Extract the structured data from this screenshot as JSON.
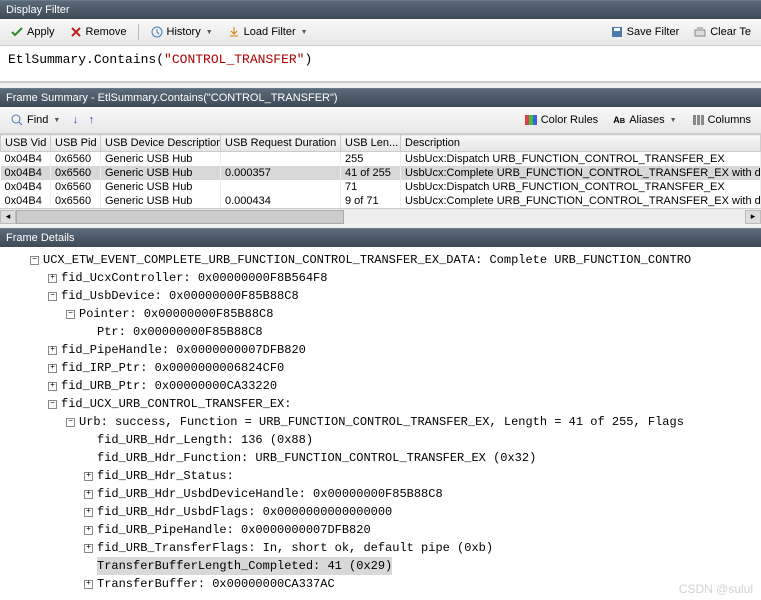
{
  "display_filter": {
    "title": "Display Filter",
    "apply": "Apply",
    "remove": "Remove",
    "history": "History",
    "load_filter": "Load Filter",
    "save_filter": "Save Filter",
    "clear_text": "Clear Te",
    "expr_fn": "EtlSummary.Contains",
    "expr_arg": "\"CONTROL_TRANSFER\""
  },
  "frame_summary": {
    "title": "Frame Summary - EtlSummary.Contains(\"CONTROL_TRANSFER\")",
    "find": "Find",
    "color_rules": "Color Rules",
    "aliases": "Aliases",
    "columns": "Columns",
    "headers": [
      "USB Vid",
      "USB Pid",
      "USB Device Description",
      "USB Request Duration",
      "USB Len...",
      "Description"
    ],
    "rows": [
      {
        "vid": "0x04B4",
        "pid": "0x6560",
        "desc": "Generic USB Hub",
        "dur": "",
        "len": "255",
        "d": "UsbUcx:Dispatch URB_FUNCTION_CONTROL_TRANSFER_EX",
        "sel": false
      },
      {
        "vid": "0x04B4",
        "pid": "0x6560",
        "desc": "Generic USB Hub",
        "dur": "0.000357",
        "len": "41 of 255",
        "d": "UsbUcx:Complete URB_FUNCTION_CONTROL_TRANSFER_EX with data",
        "sel": true
      },
      {
        "vid": "0x04B4",
        "pid": "0x6560",
        "desc": "Generic USB Hub",
        "dur": "",
        "len": "71",
        "d": "UsbUcx:Dispatch URB_FUNCTION_CONTROL_TRANSFER_EX",
        "sel": false
      },
      {
        "vid": "0x04B4",
        "pid": "0x6560",
        "desc": "Generic USB Hub",
        "dur": "0.000434",
        "len": "9 of 71",
        "d": "UsbUcx:Complete URB_FUNCTION_CONTROL_TRANSFER_EX with data",
        "sel": false
      }
    ]
  },
  "frame_details": {
    "title": "Frame Details",
    "lines": [
      {
        "ind": 1,
        "box": "-",
        "txt": "UCX_ETW_EVENT_COMPLETE_URB_FUNCTION_CONTROL_TRANSFER_EX_DATA: Complete URB_FUNCTION_CONTRO"
      },
      {
        "ind": 2,
        "box": "+",
        "txt": "fid_UcxController: 0x00000000F8B564F8"
      },
      {
        "ind": 2,
        "box": "-",
        "txt": "fid_UsbDevice: 0x00000000F85B88C8"
      },
      {
        "ind": 3,
        "box": "-",
        "txt": "Pointer: 0x00000000F85B88C8"
      },
      {
        "ind": 4,
        "box": "",
        "txt": "Ptr: 0x00000000F85B88C8"
      },
      {
        "ind": 2,
        "box": "+",
        "txt": "fid_PipeHandle: 0x0000000007DFB820"
      },
      {
        "ind": 2,
        "box": "+",
        "txt": "fid_IRP_Ptr: 0x0000000006824CF0"
      },
      {
        "ind": 2,
        "box": "+",
        "txt": "fid_URB_Ptr: 0x00000000CA33220"
      },
      {
        "ind": 2,
        "box": "-",
        "txt": "fid_UCX_URB_CONTROL_TRANSFER_EX:"
      },
      {
        "ind": 3,
        "box": "-",
        "txt": "Urb: success, Function = URB_FUNCTION_CONTROL_TRANSFER_EX, Length = 41 of 255, Flags "
      },
      {
        "ind": 4,
        "box": "",
        "txt": "fid_URB_Hdr_Length: 136 (0x88)"
      },
      {
        "ind": 4,
        "box": "",
        "txt": "fid_URB_Hdr_Function: URB_FUNCTION_CONTROL_TRANSFER_EX (0x32)"
      },
      {
        "ind": 4,
        "box": "+",
        "txt": "fid_URB_Hdr_Status:"
      },
      {
        "ind": 4,
        "box": "+",
        "txt": "fid_URB_Hdr_UsbdDeviceHandle: 0x00000000F85B88C8"
      },
      {
        "ind": 4,
        "box": "+",
        "txt": "fid_URB_Hdr_UsbdFlags: 0x0000000000000000"
      },
      {
        "ind": 4,
        "box": "+",
        "txt": "fid_URB_PipeHandle: 0x0000000007DFB820"
      },
      {
        "ind": 4,
        "box": "+",
        "txt": "fid_URB_TransferFlags: In, short ok, default pipe (0xb)"
      },
      {
        "ind": 4,
        "box": "",
        "txt": "TransferBufferLength_Completed: 41 (0x29)",
        "hl": true
      },
      {
        "ind": 4,
        "box": "+",
        "txt": "TransferBuffer: 0x00000000CA337AC"
      }
    ]
  },
  "watermark": "CSDN @sulul"
}
